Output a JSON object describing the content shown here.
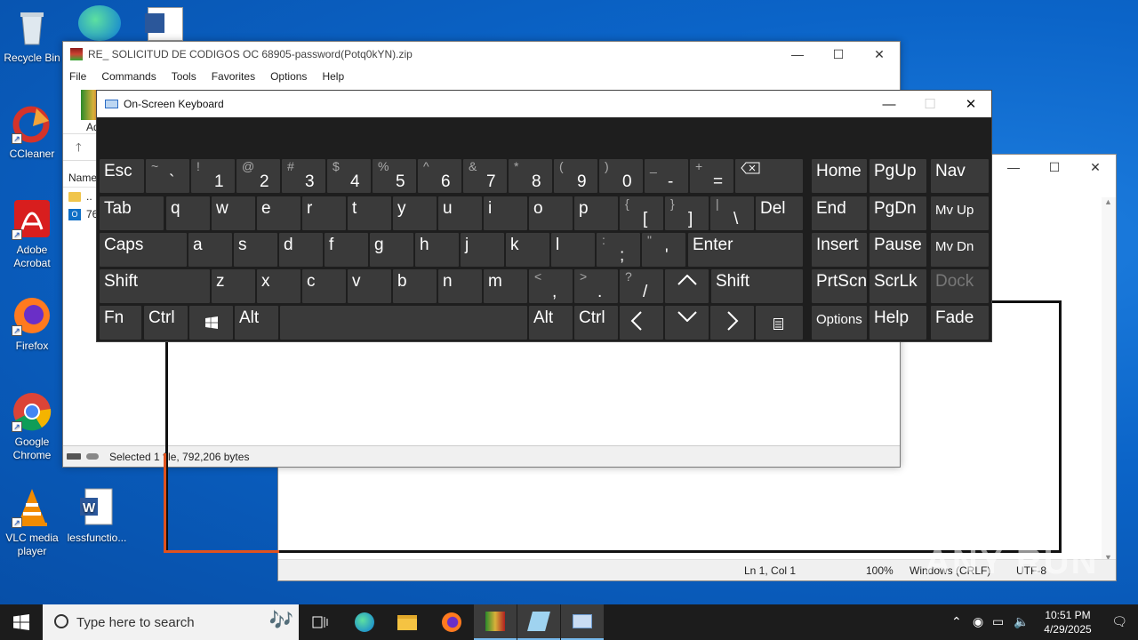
{
  "desktop": {
    "icons": [
      {
        "label": "Recycle Bin",
        "icon": "recycle-bin-icon"
      },
      {
        "label": "CCleaner",
        "icon": "ccleaner-icon"
      },
      {
        "label": "Adobe Acrobat",
        "icon": "acrobat-icon"
      },
      {
        "label": "Firefox",
        "icon": "firefox-icon"
      },
      {
        "label": "Google Chrome",
        "icon": "chrome-icon"
      },
      {
        "label": "VLC media player",
        "icon": "vlc-icon"
      },
      {
        "label": "lessfunctio...",
        "icon": "word-doc-icon"
      }
    ]
  },
  "winrar": {
    "title": "RE_ SOLICITUD DE CODIGOS OC 68905-password(Potq0kYN).zip",
    "menu": [
      "File",
      "Commands",
      "Tools",
      "Favorites",
      "Options",
      "Help"
    ],
    "toolbar_label": "Ad",
    "column_name": "Name",
    "files": [
      {
        "name": "..",
        "icon": "folder-icon"
      },
      {
        "name": "76",
        "icon": "outlook-msg-icon"
      }
    ],
    "status": "Selected 1 file, 792,206 bytes"
  },
  "notepad": {
    "status": {
      "position": "Ln 1, Col 1",
      "zoom": "100%",
      "line_ending": "Windows (CRLF)",
      "encoding": "UTF-8"
    }
  },
  "osk": {
    "title": "On-Screen Keyboard",
    "keys": {
      "esc": "Esc",
      "tab": "Tab",
      "caps": "Caps",
      "shift_l": "Shift",
      "fn": "Fn",
      "ctrl_l": "Ctrl",
      "alt_l": "Alt",
      "alt_r": "Alt",
      "ctrl_r": "Ctrl",
      "del": "Del",
      "enter": "Enter",
      "shift_r": "Shift",
      "home": "Home",
      "pgup": "PgUp",
      "nav": "Nav",
      "end": "End",
      "pgdn": "PgDn",
      "mvup": "Mv Up",
      "insert": "Insert",
      "pause": "Pause",
      "mvdn": "Mv Dn",
      "prtscn": "PrtScn",
      "scrlk": "ScrLk",
      "dock": "Dock",
      "options": "Options",
      "help": "Help",
      "fade": "Fade"
    },
    "row1": [
      {
        "top": "~",
        "bot": "`"
      },
      {
        "top": "!",
        "bot": "1"
      },
      {
        "top": "@",
        "bot": "2"
      },
      {
        "top": "#",
        "bot": "3"
      },
      {
        "top": "$",
        "bot": "4"
      },
      {
        "top": "%",
        "bot": "5"
      },
      {
        "top": "^",
        "bot": "6"
      },
      {
        "top": "&",
        "bot": "7"
      },
      {
        "top": "*",
        "bot": "8"
      },
      {
        "top": "(",
        "bot": "9"
      },
      {
        "top": ")",
        "bot": "0"
      },
      {
        "top": "_",
        "bot": "-"
      },
      {
        "top": "+",
        "bot": "="
      }
    ],
    "row2": [
      "q",
      "w",
      "e",
      "r",
      "t",
      "y",
      "u",
      "i",
      "o",
      "p"
    ],
    "row2_sym": [
      {
        "top": "{",
        "bot": "["
      },
      {
        "top": "}",
        "bot": "]"
      },
      {
        "top": "|",
        "bot": "\\"
      }
    ],
    "row3": [
      "a",
      "s",
      "d",
      "f",
      "g",
      "h",
      "j",
      "k",
      "l"
    ],
    "row3_sym": [
      {
        "top": ":",
        "bot": ";"
      },
      {
        "top": "\"",
        "bot": "'"
      }
    ],
    "row4": [
      "z",
      "x",
      "c",
      "v",
      "b",
      "n",
      "m"
    ],
    "row4_sym": [
      {
        "top": "<",
        "bot": ","
      },
      {
        "top": ">",
        "bot": "."
      },
      {
        "top": "?",
        "bot": "/"
      }
    ]
  },
  "taskbar": {
    "search_placeholder": "Type here to search",
    "time": "10:51 PM",
    "date": "4/29/2025"
  },
  "watermark": "ANY RUN"
}
